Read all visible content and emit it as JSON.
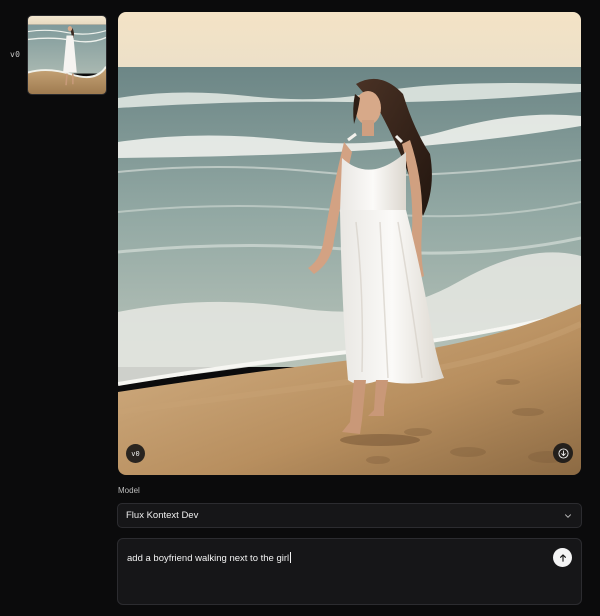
{
  "versions": [
    {
      "label": "v0",
      "thumbnail_alt": "woman in white dress walking on beach"
    }
  ],
  "preview": {
    "badge": "v0",
    "download_icon": "download-icon"
  },
  "model": {
    "label": "Model",
    "selected": "Flux Kontext Dev",
    "icon": "chevron-down-icon"
  },
  "prompt": {
    "value": "add a boyfriend walking next to the girl",
    "send_icon": "arrow-up-icon"
  },
  "colors": {
    "background": "#0b0b0c",
    "panel": "#161618",
    "border": "#2c2c30",
    "send_button": "#f4f4f4"
  }
}
